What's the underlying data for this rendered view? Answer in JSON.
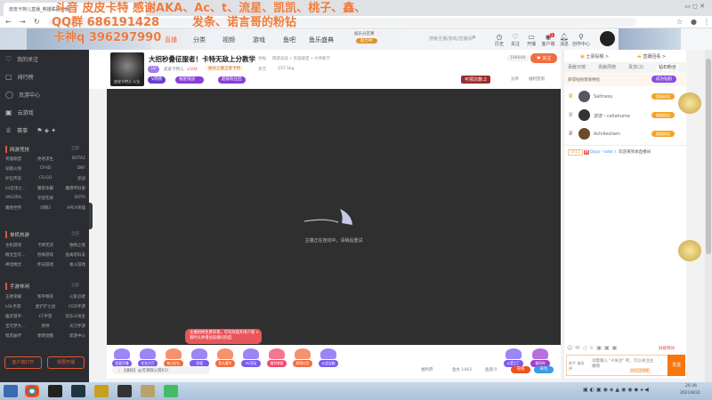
{
  "browser": {
    "tab_title": "皮皮卡特儿直播_英雄联盟直播",
    "time": "20:36",
    "date": "2021/8/31"
  },
  "overlay": {
    "line1": "斗音 皮皮卡特 感谢AKA、Ac、t、流星、凯凯、桃子、鑫、",
    "line2": "QQ群 686191428",
    "line2b": "发条、诺言哥的粉钻",
    "line3": "卡神q 396297990"
  },
  "header": {
    "nav": [
      "直播",
      "分类",
      "视频",
      "游戏",
      "鱼吧",
      "鱼乐盛典"
    ],
    "promo": "娱乐分区赛",
    "promo_btn": "助力中",
    "search_placeholder": "搜索主播/游戏/直播间",
    "icons": [
      "历史",
      "关注",
      "开播",
      "客户端",
      "消息",
      "创作中心"
    ],
    "client_badge": "1"
  },
  "sidebar": {
    "items": [
      "我的关注",
      "排行榜",
      "页游中心",
      "云游戏",
      "赛事"
    ],
    "sections": [
      {
        "title": "网游竞技",
        "more": "全部",
        "games": [
          "英雄联盟",
          "绝地求生",
          "DOTA2",
          "穿越火线",
          "CFHD",
          "DNF",
          "炉石传说",
          "CS:GO",
          "逆战",
          "lol云顶之...",
          "魔兽争霸",
          "魔兽怀旧服",
          "VALORA...",
          "守望先锋",
          "DOTA",
          "魔兽世界",
          "剑网3",
          "APEX英雄"
        ]
      },
      {
        "title": "单机热游",
        "more": "全部",
        "games": [
          "主机游戏",
          "卡牌无双",
          "独畅之境",
          "精灵宝可...",
          "恐怖游戏",
          "逃离塔科夫",
          "神话精灵",
          "怀旧游戏",
          "格斗游戏"
        ]
      },
      {
        "title": "手游休闲",
        "more": "全部",
        "games": [
          "王者荣耀",
          "和平精英",
          "火影忍者",
          "LOL手游",
          "金铲铲之战",
          "COD手游",
          "幽灵猎手...",
          "CF手游",
          "欢乐斗地主",
          "宝可梦大...",
          "原神",
          "天刀手游",
          "暗黑破坏",
          "黎明觉醒",
          "新游中心"
        ]
      }
    ],
    "btn_client": "客户端打开",
    "btn_live": "我要开播"
  },
  "room": {
    "title": "大招秒叠征服者！卡特无敌上分教学",
    "report": "举报",
    "category": "网游竞技 • 英雄联盟 • 大神教学",
    "level_tag": "LV",
    "streamer": "皮皮卡特儿",
    "hot": "104",
    "rank_tag": "峡谷之巅王者卡特",
    "fans": "亲万",
    "weight": "237.5kg",
    "tag1": "V周榜",
    "tag2": "福星挑战",
    "tag3": "超级粉丝团",
    "follow_count": "198608",
    "follow_btn": "关注",
    "lottery": "可领次数:2",
    "share": "分享",
    "sign": "福利签到",
    "avatar_label": "皮皮卡特儿 公告"
  },
  "video": {
    "loading": "主播正在连线中，请稍后重试"
  },
  "tooltip": {
    "text": "主播始终免费背景，可有效提升用户观看时长并增加直播间热度"
  },
  "gifts": [
    {
      "label": "我要开播",
      "color": "#7b5cf0"
    },
    {
      "label": "任务大厅",
      "color": "#7b5cf0"
    },
    {
      "label": "每日好礼",
      "color": "#f26d3d"
    },
    {
      "label": "鱼塘",
      "color": "#7b5cf0"
    },
    {
      "label": "鱼丸暖冬",
      "color": "#f26d3d"
    },
    {
      "label": "PK活动",
      "color": "#7b5cf0"
    },
    {
      "label": "福利掌握",
      "color": "#f04a6a"
    },
    {
      "label": "周期红包",
      "color": "#f26d3d"
    },
    {
      "label": "公会宝箱",
      "color": "#7b5cf0"
    }
  ],
  "gifts_right": [
    {
      "label": "火箭工厂",
      "color": "#7b5cf0"
    },
    {
      "label": "福利时",
      "color": "#a040d0"
    }
  ],
  "notice": "【通知】@可领取火箭X1！",
  "bottom": {
    "welfare": "福利券",
    "yuwan": "鱼丸 1443",
    "yuchi": "鱼翅 0",
    "recharge": "充值",
    "backpack": "背包"
  },
  "chat": {
    "top1": "土豪投稿 >",
    "top2": "直播回看 >",
    "tabs": [
      "贡献日榜",
      "贡献周榜",
      "贵宾(2)",
      "钻石粉丝"
    ],
    "promo": "获得钻粉增值特权",
    "promo_btn": "成为钻粉",
    "ranks": [
      {
        "name": "Saltness",
        "badge": "超级粉丝"
      },
      {
        "name": "波波丶ceilahume",
        "badge": "超级粉丝"
      },
      {
        "name": "Achillesliam",
        "badge": "超级粉丝"
      }
    ],
    "msg_level": "LV11",
    "msg_user": "Days丶later丿",
    "msg_text": "欢迎来到本直播间",
    "shield": "屏蔽特效",
    "input_placeholder": "试着输入 \"#关注\" 吧，可以关注主播哦",
    "input_tag": "粉丝团弹幕",
    "send": "发送",
    "input_left": "新手 请选择"
  }
}
